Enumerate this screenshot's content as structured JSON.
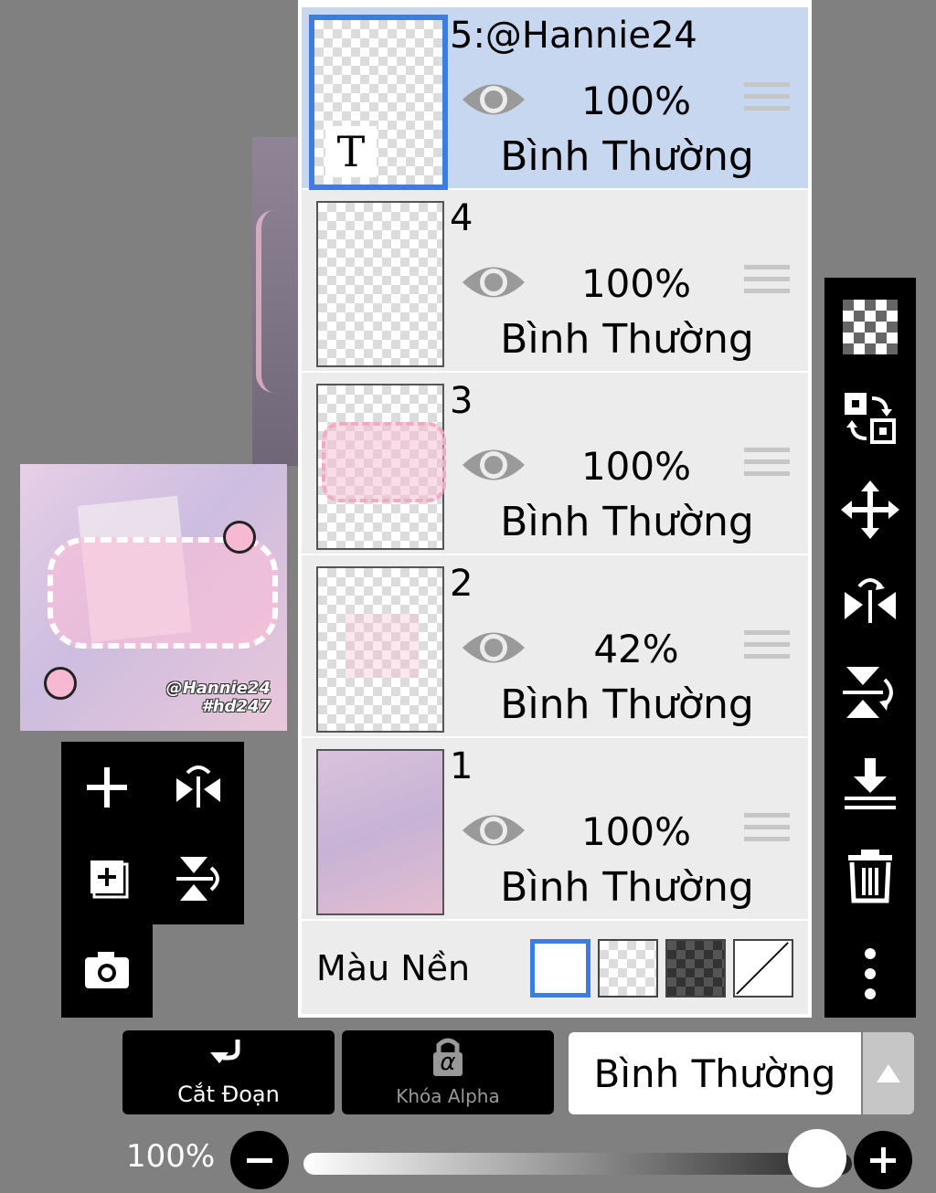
{
  "layers": [
    {
      "name": "5:@Hannie24",
      "opacity": "100%",
      "blend": "Bình Thường",
      "selected": true,
      "thumb_text": "T"
    },
    {
      "name": "4",
      "opacity": "100%",
      "blend": "Bình Thường",
      "selected": false
    },
    {
      "name": "3",
      "opacity": "100%",
      "blend": "Bình Thường",
      "selected": false
    },
    {
      "name": "2",
      "opacity": "42%",
      "blend": "Bình Thường",
      "selected": false
    },
    {
      "name": "1",
      "opacity": "100%",
      "blend": "Bình Thường",
      "selected": false
    }
  ],
  "background": {
    "label": "Màu Nền",
    "swatches": [
      "white",
      "checker-light",
      "checker-dark",
      "none"
    ],
    "selected": "white"
  },
  "canvas_preview": {
    "watermark_line1": "@Hannie24",
    "watermark_line2": "#hd247"
  },
  "left_tools": [
    "add-layer-icon",
    "flip-horizontal-icon",
    "copy-layer-icon",
    "flip-vertical-icon",
    "camera-icon"
  ],
  "right_tools": [
    "transparency-icon",
    "swap-layers-icon",
    "move-icon",
    "flip-horizontal-icon",
    "flip-vertical-icon",
    "merge-down-icon",
    "trash-icon",
    "more-icon"
  ],
  "bottom": {
    "clip_label": "Cắt Đoạn",
    "alpha_lock_label": "Khóa Alpha",
    "alpha_symbol": "α",
    "blend_mode": "Bình Thường",
    "opacity_label": "100%",
    "opacity_value": 1.0
  },
  "colors": {
    "accent": "#3b7de0",
    "selected_row": "#c7d7ef",
    "row": "#ececec",
    "panel_bg": "#808080"
  }
}
